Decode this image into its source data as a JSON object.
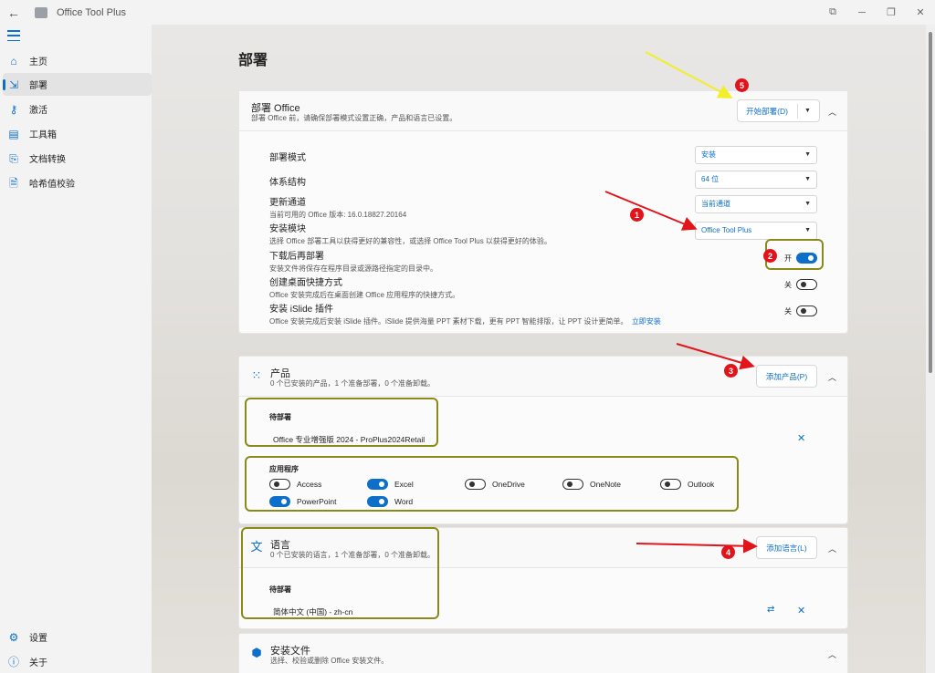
{
  "window": {
    "title": "Office Tool Plus",
    "back_icon": "arrow-left-icon",
    "controls": [
      "feedback-icon",
      "minimize-icon",
      "restore-icon",
      "close-icon"
    ]
  },
  "sidebar": {
    "items": [
      {
        "label": "主页",
        "icon": "home-icon"
      },
      {
        "label": "部署",
        "icon": "deploy-icon"
      },
      {
        "label": "激活",
        "icon": "key-icon"
      },
      {
        "label": "工具箱",
        "icon": "toolbox-icon"
      },
      {
        "label": "文档转换",
        "icon": "document-convert-icon"
      },
      {
        "label": "哈希值校验",
        "icon": "hash-check-icon"
      }
    ],
    "bottom": [
      {
        "label": "设置",
        "icon": "gear-icon"
      },
      {
        "label": "关于",
        "icon": "info-icon"
      }
    ]
  },
  "page": {
    "title": "部署"
  },
  "deploy_card": {
    "title": "部署 Office",
    "subtitle": "部署 Office 前，请确保部署模式设置正确，产品和语言已设置。",
    "start_button": "开始部署(D)",
    "rows": [
      {
        "title": "部署模式",
        "value": "安装"
      },
      {
        "title": "体系结构",
        "value": "64 位"
      },
      {
        "title": "更新通道",
        "subtitle": "当前可用的 Office 版本: 16.0.18827.20164",
        "value": "当前通道"
      },
      {
        "title": "安装模块",
        "subtitle": "选择 Office 部署工具以获得更好的兼容性，或选择 Office Tool Plus 以获得更好的体验。",
        "value": "Office Tool Plus"
      },
      {
        "title": "下载后再部署",
        "subtitle": "安装文件将保存在程序目录或源路径指定的目录中。",
        "toggle_label": "开",
        "toggle_on": true
      },
      {
        "title": "创建桌面快捷方式",
        "subtitle": "Office 安装完成后在桌面创建 Office 应用程序的快捷方式。",
        "toggle_label": "关",
        "toggle_on": false
      },
      {
        "title": "安装 iSlide 插件",
        "subtitle": "Office 安装完成后安装 iSlide 插件。iSlide 提供海量 PPT 素材下载，更有 PPT 智能排版，让 PPT 设计更简单。",
        "link": "立即安装",
        "toggle_label": "关",
        "toggle_on": false
      }
    ]
  },
  "products_card": {
    "title": "产品",
    "subtitle": "0 个已安装的产品，1 个准备部署，0 个准备卸载。",
    "add_button": "添加产品(P)",
    "pending_label": "待部署",
    "pending_item": "Office 专业增强版 2024  -  ProPlus2024Retail",
    "apps_label": "应用程序",
    "apps": [
      {
        "name": "Access",
        "on": false
      },
      {
        "name": "Excel",
        "on": true
      },
      {
        "name": "OneDrive",
        "on": false
      },
      {
        "name": "OneNote",
        "on": false
      },
      {
        "name": "Outlook",
        "on": false
      },
      {
        "name": "PowerPoint",
        "on": true
      },
      {
        "name": "Word",
        "on": true
      }
    ]
  },
  "language_card": {
    "title": "语言",
    "subtitle": "0 个已安装的语言，1 个准备部署，0 个准备卸载。",
    "add_button": "添加语言(L)",
    "pending_label": "待部署",
    "pending_item": "简体中文 (中国)  -  zh-cn"
  },
  "files_card": {
    "title": "安装文件",
    "subtitle": "选择、校验或删除 Office 安装文件。"
  },
  "annotations": {
    "numbers": [
      "1",
      "2",
      "3",
      "4",
      "5"
    ],
    "arrow_colors": {
      "red": "#e1141b",
      "yellow": "#f2ee2a"
    },
    "box_color": "#8a8a1a"
  }
}
